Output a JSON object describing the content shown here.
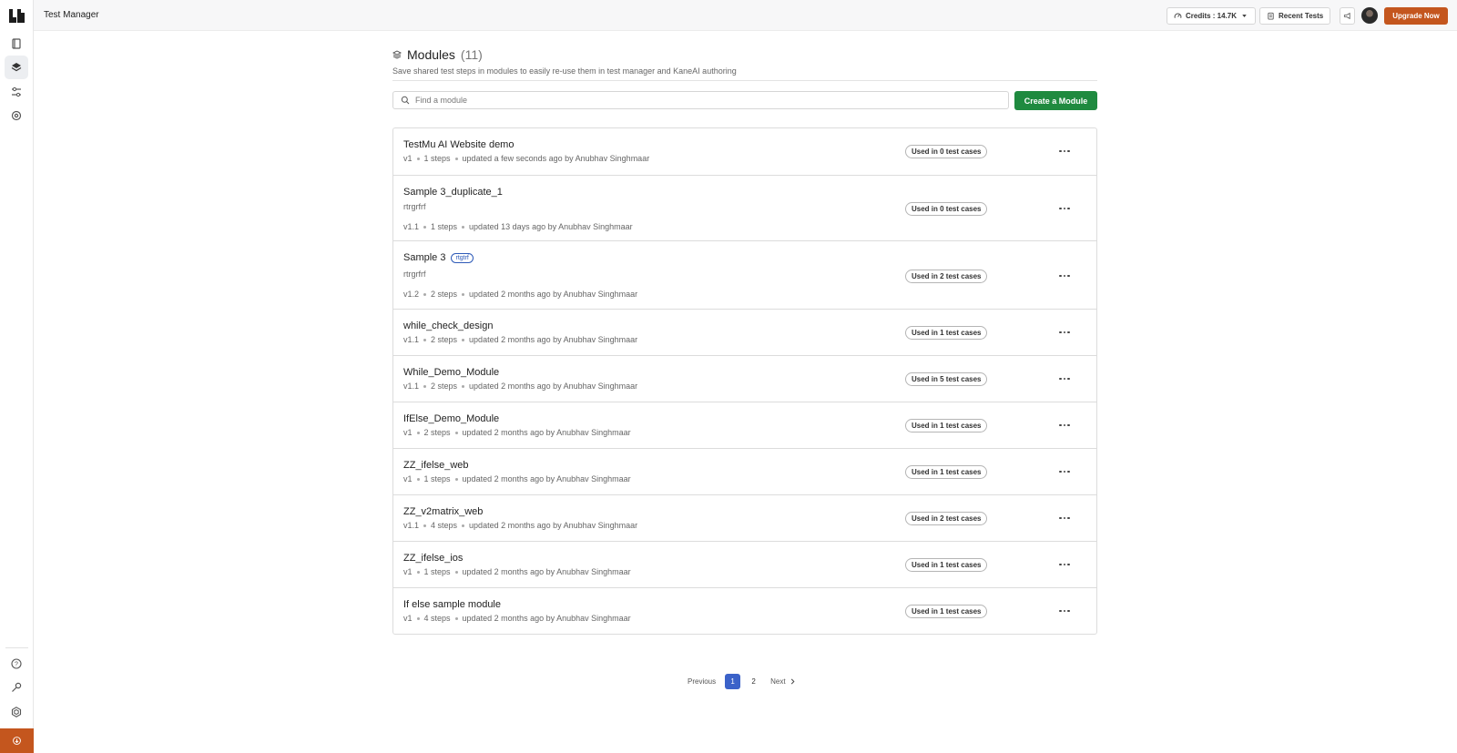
{
  "topbar": {
    "app_title": "Test Manager",
    "credits_label": "Credits : 14.7K",
    "recent_tests_label": "Recent Tests",
    "upgrade_label": "Upgrade Now"
  },
  "page": {
    "title": "Modules",
    "count": "(11)",
    "subtitle": "Save shared test steps in modules to easily re-use them in test manager and KaneAI authoring"
  },
  "search": {
    "placeholder": "Find a module"
  },
  "actions": {
    "create_label": "Create a Module"
  },
  "modules": [
    {
      "name": "TestMu AI Website demo",
      "tag": "",
      "description": "",
      "version": "v1",
      "steps": "1 steps",
      "updated": "updated a few seconds ago by Anubhav Singhmaar",
      "usage": "Used in 0 test cases"
    },
    {
      "name": "Sample 3_duplicate_1",
      "tag": "",
      "description": "rtrgrfrf",
      "version": "v1.1",
      "steps": "1 steps",
      "updated": "updated 13 days ago by Anubhav Singhmaar",
      "usage": "Used in 0 test cases"
    },
    {
      "name": "Sample 3",
      "tag": "rtgtrf",
      "description": "rtrgrfrf",
      "version": "v1.2",
      "steps": "2 steps",
      "updated": "updated 2 months ago by Anubhav Singhmaar",
      "usage": "Used in 2 test cases"
    },
    {
      "name": "while_check_design",
      "tag": "",
      "description": "",
      "version": "v1.1",
      "steps": "2 steps",
      "updated": "updated 2 months ago by Anubhav Singhmaar",
      "usage": "Used in 1 test cases"
    },
    {
      "name": "While_Demo_Module",
      "tag": "",
      "description": "",
      "version": "v1.1",
      "steps": "2 steps",
      "updated": "updated 2 months ago by Anubhav Singhmaar",
      "usage": "Used in 5 test cases"
    },
    {
      "name": "IfElse_Demo_Module",
      "tag": "",
      "description": "",
      "version": "v1",
      "steps": "2 steps",
      "updated": "updated 2 months ago by Anubhav Singhmaar",
      "usage": "Used in 1 test cases"
    },
    {
      "name": "ZZ_ifelse_web",
      "tag": "",
      "description": "",
      "version": "v1",
      "steps": "1 steps",
      "updated": "updated 2 months ago by Anubhav Singhmaar",
      "usage": "Used in 1 test cases"
    },
    {
      "name": "ZZ_v2matrix_web",
      "tag": "",
      "description": "",
      "version": "v1.1",
      "steps": "4 steps",
      "updated": "updated 2 months ago by Anubhav Singhmaar",
      "usage": "Used in 2 test cases"
    },
    {
      "name": "ZZ_ifelse_ios",
      "tag": "",
      "description": "",
      "version": "v1",
      "steps": "1 steps",
      "updated": "updated 2 months ago by Anubhav Singhmaar",
      "usage": "Used in 1 test cases"
    },
    {
      "name": "If else sample module",
      "tag": "",
      "description": "",
      "version": "v1",
      "steps": "4 steps",
      "updated": "updated 2 months ago by Anubhav Singhmaar",
      "usage": "Used in 1 test cases"
    }
  ],
  "pagination": {
    "previous_label": "Previous",
    "pages": [
      "1",
      "2"
    ],
    "current": "1",
    "next_label": "Next"
  },
  "icons": {
    "logo": "brand-logo-icon",
    "rail_top": [
      "book-icon",
      "layers-icon",
      "sliders-icon",
      "gear-icon"
    ],
    "rail_bottom": [
      "help-circle-icon",
      "key-icon",
      "hexagon-icon",
      "circle-arrow-icon"
    ]
  },
  "colors": {
    "accent": "#c4561e",
    "primary_green": "#1f8a3f",
    "page_active": "#3b62c9"
  }
}
